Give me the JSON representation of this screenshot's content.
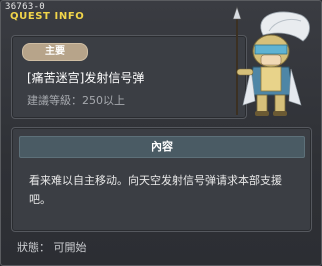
{
  "window": {
    "quest_id": "36763-0",
    "title": "QUEST INFO"
  },
  "quest": {
    "category_badge": "主要",
    "name": "[痛苦迷宫]发射信号弹",
    "level_requirement": "建議等級：250以上",
    "content_header": "內容",
    "content_text": "看来难以自主移动。向天空发射信号弹请求本部支援吧。",
    "status": "狀態： 可開始"
  },
  "icons": {
    "npc": "armored-knight-npc-portrait"
  },
  "colors": {
    "title": "#f1d54a",
    "badge": "#b7a48a",
    "content_header": "#4a5b64",
    "panel": "#3b3e44"
  }
}
